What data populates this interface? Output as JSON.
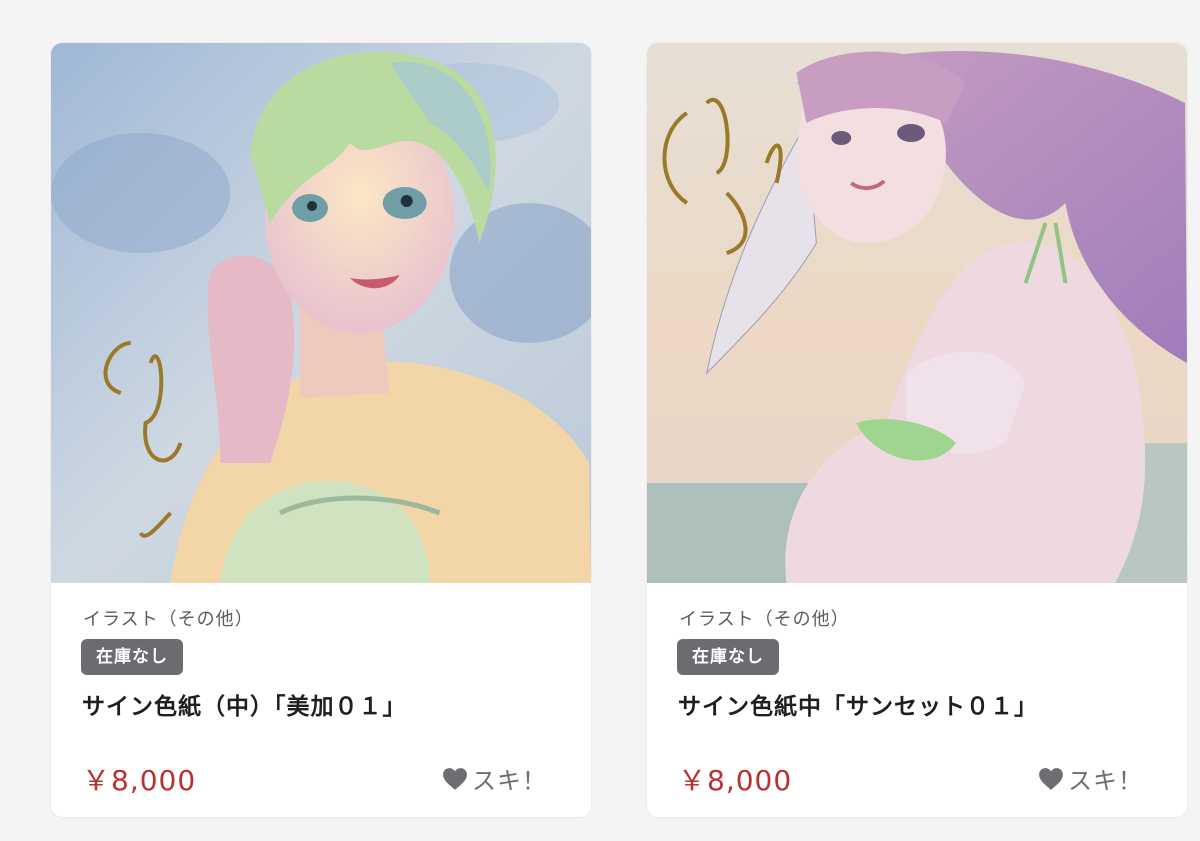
{
  "products": [
    {
      "category": "イラスト（その他）",
      "stock_badge": "在庫なし",
      "title": "サイン色紙（中）「美加０１」",
      "price": "￥8,000",
      "like_label": "スキ！",
      "like_icon": "heart-icon",
      "image_alt": "watercolor illustration of a short green-haired girl resting her chin on her hand"
    },
    {
      "category": "イラスト（その他）",
      "stock_badge": "在庫なし",
      "title": "サイン色紙中「サンセット０１」",
      "price": "￥8,000",
      "like_label": "スキ！",
      "like_icon": "heart-icon",
      "image_alt": "watercolor illustration of a long pink-haired girl in a green bikini at sunset"
    }
  ],
  "colors": {
    "price": "#b83232",
    "badge_bg": "#6b6b70",
    "category": "#5c5c60",
    "like": "#6e6e72"
  }
}
